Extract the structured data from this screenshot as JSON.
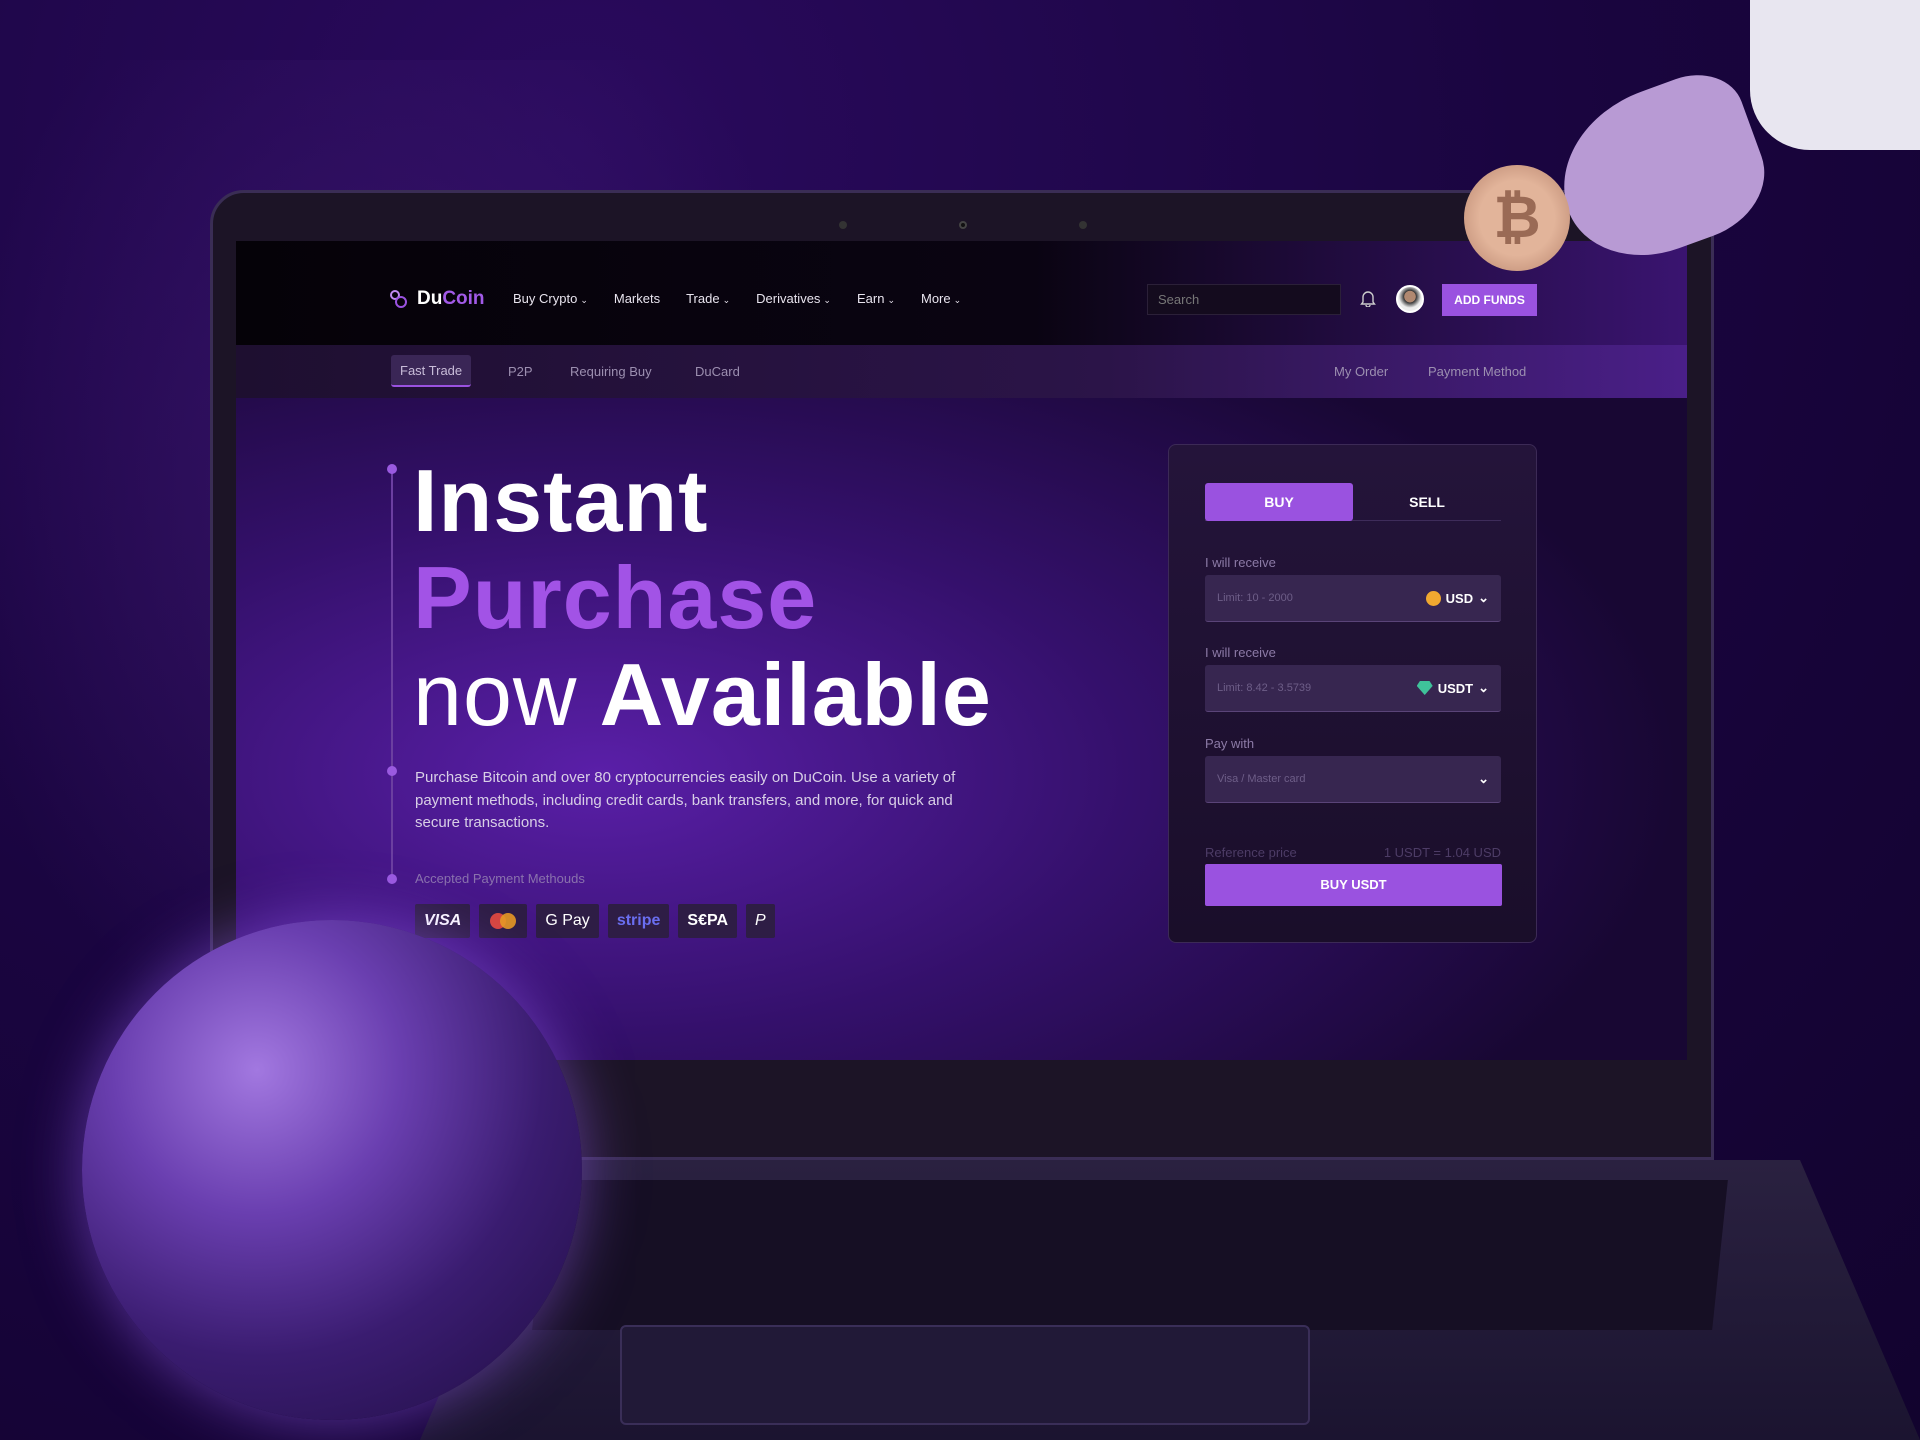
{
  "brand": {
    "name_a": "Du",
    "name_b": "Coin",
    "accent": "#9a52e0"
  },
  "nav": {
    "items": [
      {
        "label": "Buy Crypto",
        "dropdown": true
      },
      {
        "label": "Markets",
        "dropdown": false
      },
      {
        "label": "Trade",
        "dropdown": true
      },
      {
        "label": "Derivatives",
        "dropdown": true
      },
      {
        "label": "Earn",
        "dropdown": true
      },
      {
        "label": "More",
        "dropdown": true
      }
    ],
    "search_placeholder": "Search",
    "add_funds": "ADD FUNDS"
  },
  "subnav": {
    "left": [
      "Fast Trade",
      "P2P",
      "Requiring Buy",
      "DuCard"
    ],
    "right": [
      "My Order",
      "Payment Method"
    ],
    "active": "Fast Trade"
  },
  "hero": {
    "line1": "Instant",
    "line2": "Purchase",
    "line3a": "now",
    "line3b": "Available",
    "description": "Purchase Bitcoin and over 80 cryptocurrencies easily on DuCoin. Use a variety of payment methods, including credit cards, bank transfers, and more, for quick and secure transactions.",
    "accepted_label": "Accepted Payment Methouds",
    "payments": [
      "VISA",
      "Mastercard",
      "G Pay",
      "stripe",
      "S€PA",
      "PayPal"
    ]
  },
  "form": {
    "tabs": [
      "BUY",
      "SELL"
    ],
    "active_tab": "BUY",
    "field1": {
      "label": "I will receive",
      "placeholder": "Limit: 10 - 2000",
      "currency": "USD"
    },
    "field2": {
      "label": "I will receive",
      "placeholder": "Limit: 8.42 - 3.5739",
      "currency": "USDT"
    },
    "field3": {
      "label": "Pay with",
      "placeholder": "Visa / Master card"
    },
    "reference_label": "Reference price",
    "reference_value": "1 USDT = 1.04 USD",
    "submit": "BUY USDT"
  }
}
